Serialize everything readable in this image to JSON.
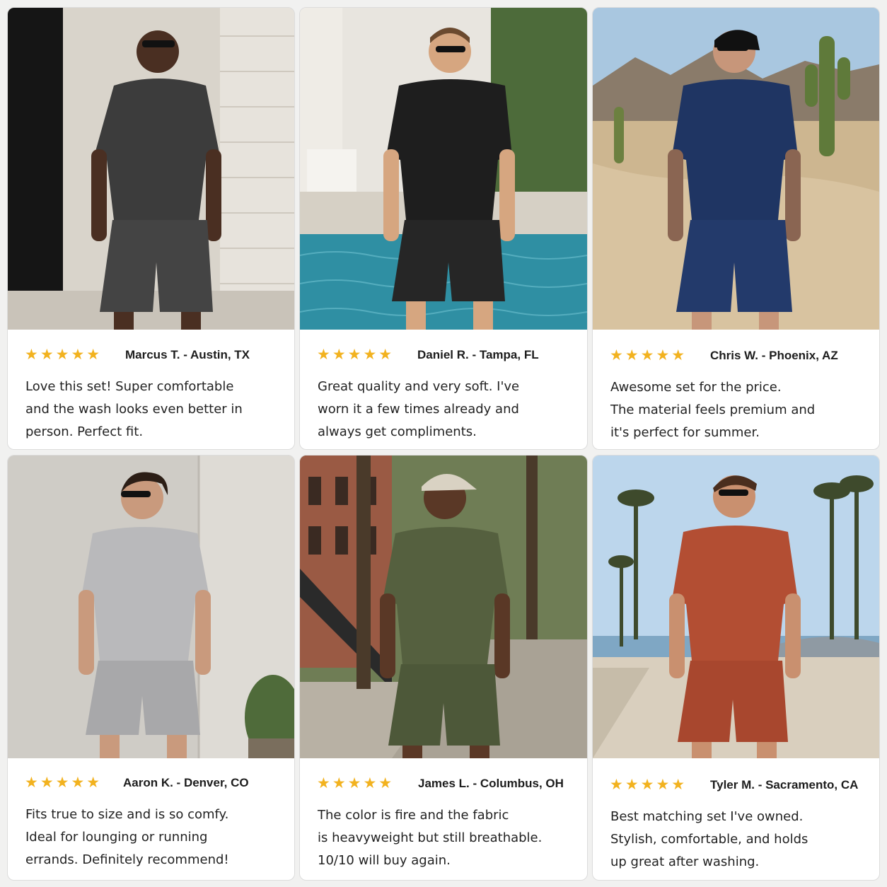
{
  "star_glyph": "★★★★★",
  "star_color": "#f2b21f",
  "reviews": [
    {
      "rating": 5,
      "reviewer": "Marcus T. - Austin, TX",
      "lines": [
        "Love this set! Super comfortable",
        "and the wash looks even better in",
        "person. Perfect fit."
      ],
      "outfit_color": "#3c3c3c",
      "scene": "light brick wall with dark door"
    },
    {
      "rating": 5,
      "reviewer": "Daniel R. - Tampa, FL",
      "lines": [
        "Great quality and very soft. I've",
        "worn it a few times already and",
        "always get compliments."
      ],
      "outfit_color": "#1e1e1e",
      "scene": "poolside with palms"
    },
    {
      "rating": 5,
      "reviewer": "Chris W. - Phoenix, AZ",
      "lines": [
        "Awesome set for the price.",
        "The material feels premium and",
        "it's perfect for summer."
      ],
      "outfit_color": "#1f3563",
      "scene": "desert trail with cactus"
    },
    {
      "rating": 5,
      "reviewer": "Aaron K. - Denver, CO",
      "lines": [
        "Fits true to size and is so comfy.",
        "Ideal for lounging or running",
        "errands. Definitely recommend!"
      ],
      "outfit_color": "#b9b9bb",
      "scene": "concrete wall with plant"
    },
    {
      "rating": 5,
      "reviewer": "James L. - Columbus, OH",
      "lines": [
        "The color is fire and the fabric",
        "is heavyweight but still breathable.",
        "10/10 will buy again."
      ],
      "outfit_color": "#55603f",
      "scene": "tree-lined city sidewalk"
    },
    {
      "rating": 5,
      "reviewer": "Tyler M. - Sacramento, CA",
      "lines": [
        "Best matching set I've owned.",
        "Stylish, comfortable, and holds",
        "up great after washing."
      ],
      "outfit_color": "#b34e33",
      "scene": "beach boardwalk with palm trees"
    }
  ]
}
